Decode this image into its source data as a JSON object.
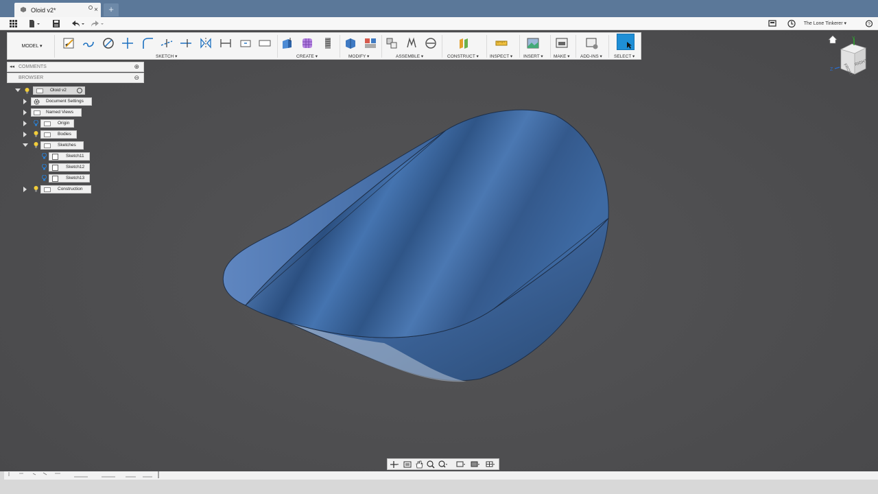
{
  "tab": {
    "title": "Oloid v2*",
    "close_glyph": "×",
    "new_glyph": "+"
  },
  "quick_access": {
    "user_name": "The Lone Tinkerer ▾"
  },
  "toolbar": {
    "workspace": "MODEL ▾",
    "groups": {
      "sketch": "SKETCH ▾",
      "create": "CREATE ▾",
      "modify": "MODIFY ▾",
      "assemble": "ASSEMBLE ▾",
      "construct": "CONSTRUCT ▾",
      "inspect": "INSPECT ▾",
      "insert": "INSERT ▾",
      "make": "MAKE ▾",
      "addins": "ADD-INS ▾",
      "select": "SELECT ▾"
    }
  },
  "panels": {
    "comments": "COMMENTS",
    "browser": "BROWSER"
  },
  "browser_tree": {
    "root": "Oloid v2",
    "document_settings": "Document Settings",
    "named_views": "Named Views",
    "origin": "Origin",
    "bodies": "Bodies",
    "sketches": "Sketches",
    "sketch11": "Sketch11",
    "sketch12": "Sketch12",
    "sketch13": "Sketch13",
    "construction": "Construction"
  },
  "viewcube": {
    "front": "FRONT",
    "right": "RIGHT",
    "axis_y": "Y",
    "axis_z": "Z"
  },
  "colors": {
    "viewport_bg": "#4d4d4f",
    "body_blue": "#3d6ea8",
    "accent_select": "#1f8fd6",
    "tabbar": "#5b7899"
  }
}
